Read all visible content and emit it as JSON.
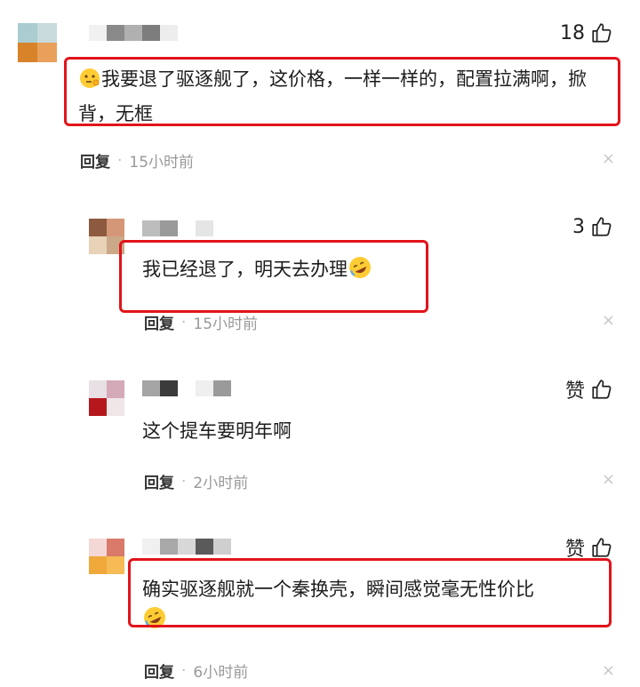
{
  "comments": [
    {
      "likes": "18",
      "text": "我要退了驱逐舰了，这价格，一样一样的，配置拉满啊，掀背，无框",
      "reply_label": "回复",
      "time": "15小时前"
    },
    {
      "likes": "3",
      "text": "我已经退了，明天去办理",
      "reply_label": "回复",
      "time": "15小时前"
    },
    {
      "likes": "赞",
      "text": "这个提车要明年啊",
      "reply_label": "回复",
      "time": "2小时前"
    },
    {
      "likes": "赞",
      "text": "确实驱逐舰就一个秦换壳，瞬间感觉毫无性价比",
      "reply_label": "回复",
      "time": "6小时前"
    }
  ],
  "separator": "·",
  "close_glyph": "×",
  "colors": {
    "highlight": "#e1141b",
    "meta": "#999999"
  },
  "icons": {
    "like": "thumbs-up-icon",
    "close": "close-icon",
    "emoji_think": "thinking-emoji-icon",
    "emoji_laugh": "rofl-emoji-icon"
  }
}
